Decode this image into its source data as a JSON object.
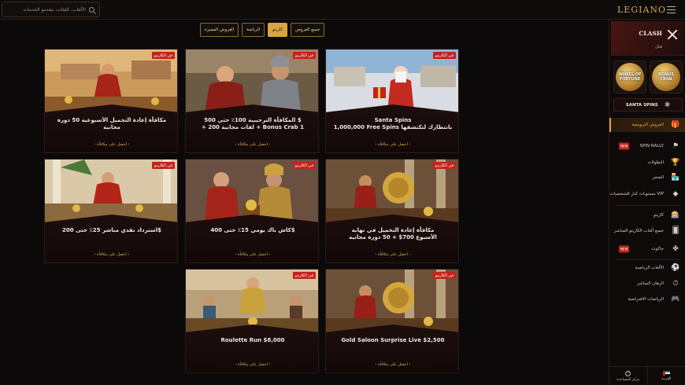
{
  "header": {
    "logo": "LEGIANO",
    "search_placeholder": "الألعاب، الفئات، مقدمو الخدمات"
  },
  "filters": [
    {
      "label": "جميع العروض",
      "active": false
    },
    {
      "label": "كازينو",
      "active": true
    },
    {
      "label": "الرياضة",
      "active": false
    },
    {
      "label": "العروض المميزة",
      "active": false
    }
  ],
  "promos": [
    {
      "badge": "في الكازينو",
      "title1": "Santa Spins",
      "title2": "1,000,000 Free Spins بانتظارك لتكتشفها",
      "link": "احصل على مكافأة",
      "scene": "santa"
    },
    {
      "badge": "في الكازينو",
      "title1": "المكافأة الترحيبية 100٪ حتى 500 $",
      "title2": "+ 200 لفات مجانية + Bonus Crab 1",
      "link": "احصل على مكافأة",
      "scene": "soldiers"
    },
    {
      "badge": "في الكازينو",
      "title1": "مكافأة إعادة التحميل الأسبوعية 50 دورة مجانية",
      "title2": "",
      "link": "احصل على مكافأة",
      "scene": "emperor"
    },
    {
      "badge": "في الكازينو",
      "title1": "مكافأة إعادة التحميل في نهاية",
      "title2": "الأسبوع 700$ + 50 دورة مجانية",
      "link": "احصل على مكافأة",
      "scene": "shield"
    },
    {
      "badge": "في الكازينو",
      "title1": "كاش باك يومي 15٪ حتى 400$",
      "title2": "",
      "link": "احصل على مكافأة",
      "scene": "soldiers2"
    },
    {
      "badge": "في الكازينو",
      "title1": "استرداد نقدي مباشر 25٪ حتى 200$",
      "title2": "",
      "link": "احصل على مكافأة",
      "scene": "temple"
    },
    {
      "badge": "في الكازينو",
      "title1": "Gold Saloon Surprise Live $2,500",
      "title2": "",
      "link": "احصل على مكافأة",
      "scene": "shield"
    },
    {
      "badge": "في الكازينو",
      "title1": "Roulette Run $8,000",
      "title2": "",
      "link": "احصل على مكافأة",
      "scene": "crowd"
    }
  ],
  "sidebar": {
    "clash_title": "CLASH",
    "clash_sub": "قتال",
    "coin1": "WHEEL OF FORTUNE",
    "coin2": "BONUS CRAB",
    "santa": "SANTA SPINS",
    "items": [
      {
        "label": "العروض الترويجية",
        "icon": "gift-icon",
        "glyph": "🎁",
        "active": true,
        "new": false
      },
      {
        "label": "SPIN RALLY",
        "icon": "flag-icon",
        "glyph": "⚑",
        "active": false,
        "new": true,
        "new_label": "NEW"
      },
      {
        "label": "البطولات",
        "icon": "trophy-icon",
        "glyph": "🏆",
        "active": false,
        "new": false
      },
      {
        "label": "المتجر",
        "icon": "shop-icon",
        "glyph": "🏪",
        "active": false,
        "new": false
      },
      {
        "label": "مستويات كبار الشخصيات VIP",
        "icon": "diamond-icon",
        "glyph": "◆",
        "active": false,
        "new": false
      },
      {
        "label": "كازينو",
        "icon": "slot-icon",
        "glyph": "🎰",
        "active": false,
        "new": false
      },
      {
        "label": "جميع ألعاب الكازينو المباشر",
        "icon": "cards-icon",
        "glyph": "🂠",
        "active": false,
        "new": false
      },
      {
        "label": "جاكوت",
        "icon": "clover-icon",
        "glyph": "✤",
        "active": false,
        "new": true,
        "new_label": "NEW"
      },
      {
        "label": "الألعاب الرياضية",
        "icon": "ball-icon",
        "glyph": "⚽",
        "active": false,
        "new": false
      },
      {
        "label": "الرهان المباشر",
        "icon": "live-icon",
        "glyph": "⏱",
        "active": false,
        "new": false
      },
      {
        "label": "الرياضات الافتراضية",
        "icon": "gamepad-icon",
        "glyph": "🎮",
        "active": false,
        "new": false
      }
    ],
    "footer_help": "مركز المساعدة",
    "footer_lang": "العربية"
  }
}
